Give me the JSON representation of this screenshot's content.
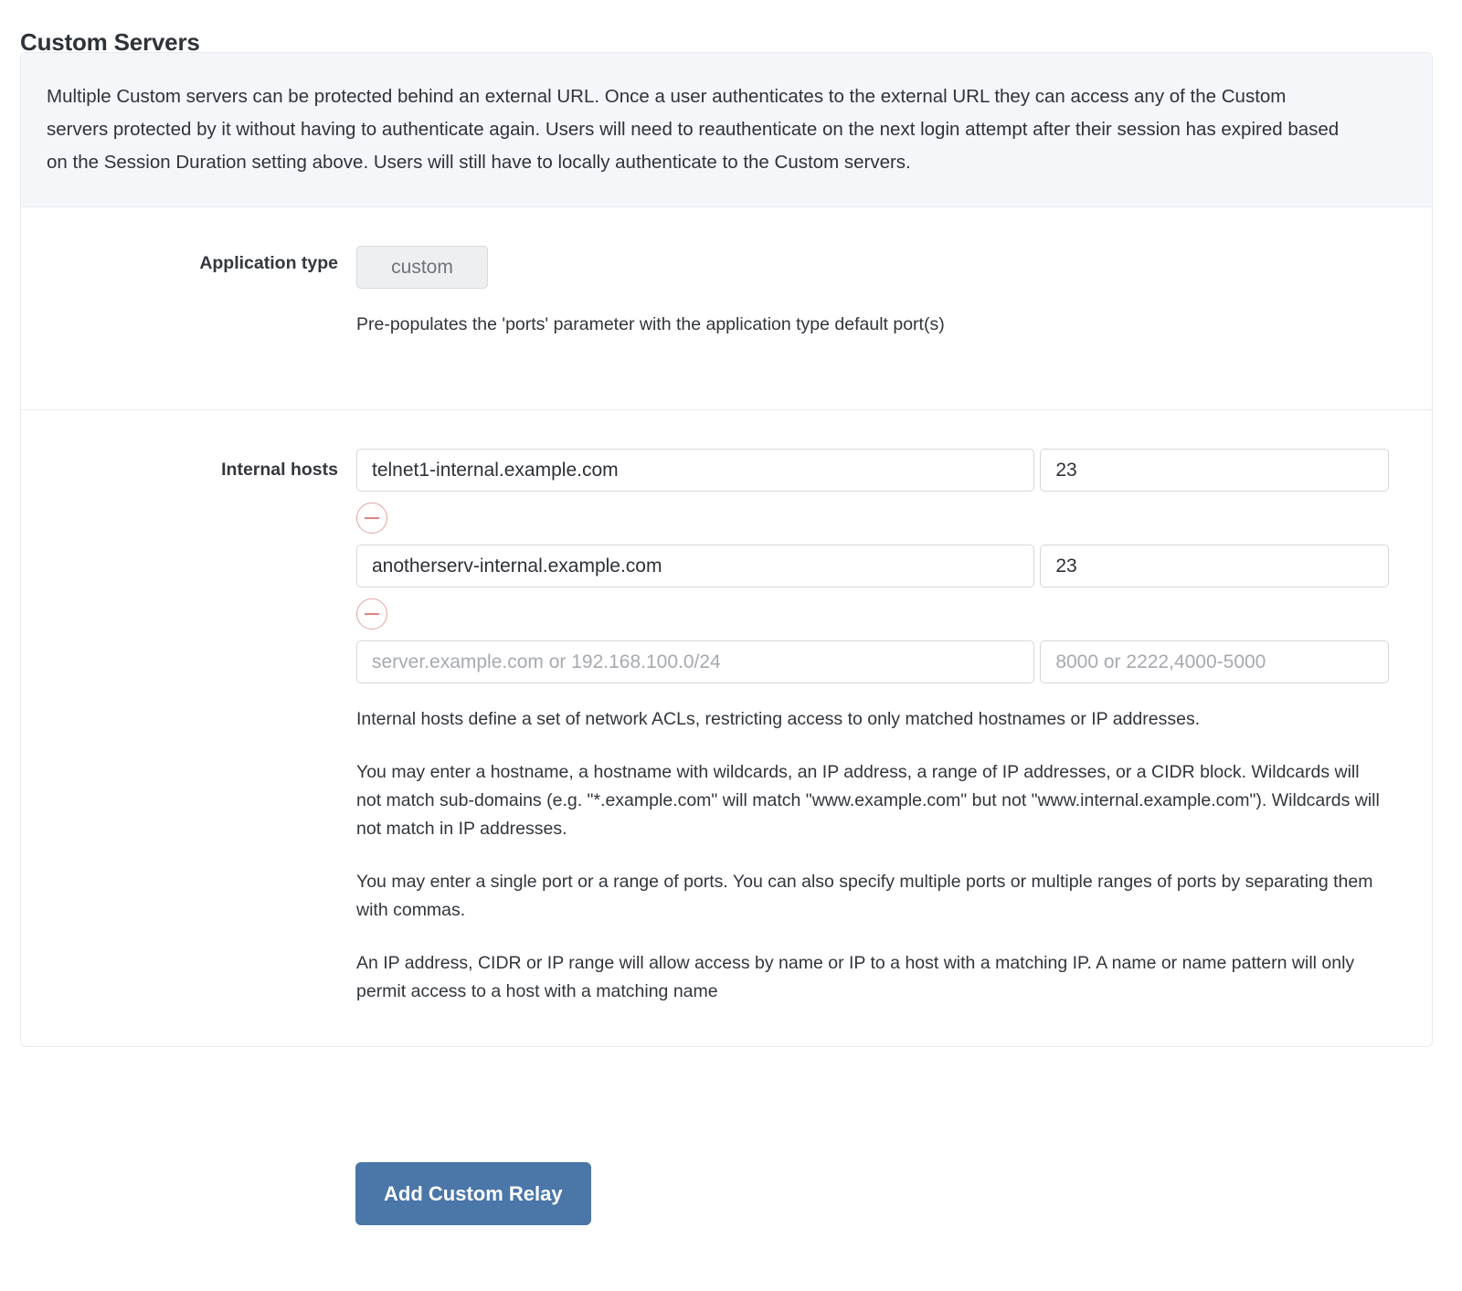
{
  "page": {
    "title": "Custom Servers"
  },
  "info_banner": {
    "text": "Multiple Custom servers can be protected behind an external URL. Once a user authenticates to the external URL they can access any of the Custom servers protected by it without having to authenticate again. Users will need to reauthenticate on the next login attempt after their session has expired based on the Session Duration setting above. Users will still have to locally authenticate to the Custom servers."
  },
  "application_type": {
    "label": "Application type",
    "value": "custom",
    "help": "Pre-populates the 'ports' parameter with the application type default port(s)"
  },
  "internal_hosts": {
    "label": "Internal hosts",
    "rows": [
      {
        "host_value": "telnet1-internal.example.com",
        "port_value": "23",
        "host_placeholder": "server.example.com or 192.168.100.0/24",
        "port_placeholder": "8000 or 2222,4000-5000",
        "removable": true
      },
      {
        "host_value": "anotherserv-internal.example.com",
        "port_value": "23",
        "host_placeholder": "server.example.com or 192.168.100.0/24",
        "port_placeholder": "8000 or 2222,4000-5000",
        "removable": true
      },
      {
        "host_value": "",
        "port_value": "",
        "host_placeholder": "server.example.com or 192.168.100.0/24",
        "port_placeholder": "8000 or 2222,4000-5000",
        "removable": false
      }
    ],
    "remove_icon": "minus-circle-icon",
    "help_paragraphs": [
      "Internal hosts define a set of network ACLs, restricting access to only matched hostnames or IP addresses.",
      "You may enter a hostname, a hostname with wildcards, an IP address, a range of IP addresses, or a CIDR block. Wildcards will not match sub-domains (e.g. \"*.example.com\" will match \"www.example.com\" but not \"www.internal.example.com\"). Wildcards will not match in IP addresses.",
      "You may enter a single port or a range of ports. You can also specify multiple ports or multiple ranges of ports by separating them with commas.",
      "An IP address, CIDR or IP range will allow access by name or IP to a host with a matching IP. A name or name pattern will only permit access to a host with a matching name"
    ]
  },
  "footer": {
    "submit_label": "Add Custom Relay"
  },
  "colors": {
    "primary_button": "#4a76a8",
    "banner_background": "#f4f6fa",
    "card_border": "#e6eaf0",
    "remove_icon": "#e8a0a0"
  }
}
